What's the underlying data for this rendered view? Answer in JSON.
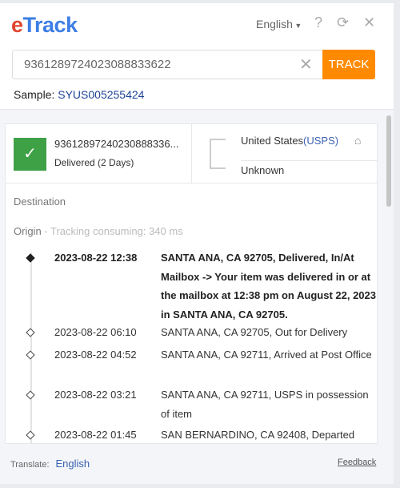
{
  "header": {
    "logo_e": "e",
    "logo_rest": "Track",
    "language": "English",
    "help_icon": "?",
    "refresh_icon": "⟳",
    "close_icon": "✕"
  },
  "search": {
    "value": "9361289724023088833622",
    "clear_icon": "✕",
    "track_label": "TRACK",
    "sample_label": "Sample:",
    "sample_value": "SYUS005255424"
  },
  "summary": {
    "number": "93612897240230888336...",
    "status": "Delivered (2 Days)",
    "origin_country": "United States",
    "carrier": "(USPS)",
    "destination": "Unknown"
  },
  "labels": {
    "destination": "Destination",
    "origin": "Origin",
    "consuming": " - Tracking consuming: 340 ms"
  },
  "events": [
    {
      "date": "2023-08-22 12:38",
      "desc": "SANTA ANA, CA 92705, Delivered, In/At Mailbox -> Your item was delivered in or at the mailbox at 12:38 pm on August 22, 2023 in SANTA ANA, CA 92705."
    },
    {
      "date": "2023-08-22 06:10",
      "desc": "SANTA ANA, CA 92705, Out for Delivery"
    },
    {
      "date": "2023-08-22 04:52",
      "desc": "SANTA ANA, CA 92711, Arrived at Post Office"
    },
    {
      "date": "2023-08-22 03:21",
      "desc": "SANTA ANA, CA 92711, USPS in possession of item"
    },
    {
      "date": "2023-08-22 01:45",
      "desc": "SAN BERNARDINO, CA 92408, Departed"
    }
  ],
  "footer": {
    "translate_label": "Translate:",
    "translate_value": "English",
    "feedback": "Feedback"
  },
  "colors": {
    "accent": "#ff8a00",
    "delivered": "#3ea146",
    "link": "#3f63b5"
  }
}
